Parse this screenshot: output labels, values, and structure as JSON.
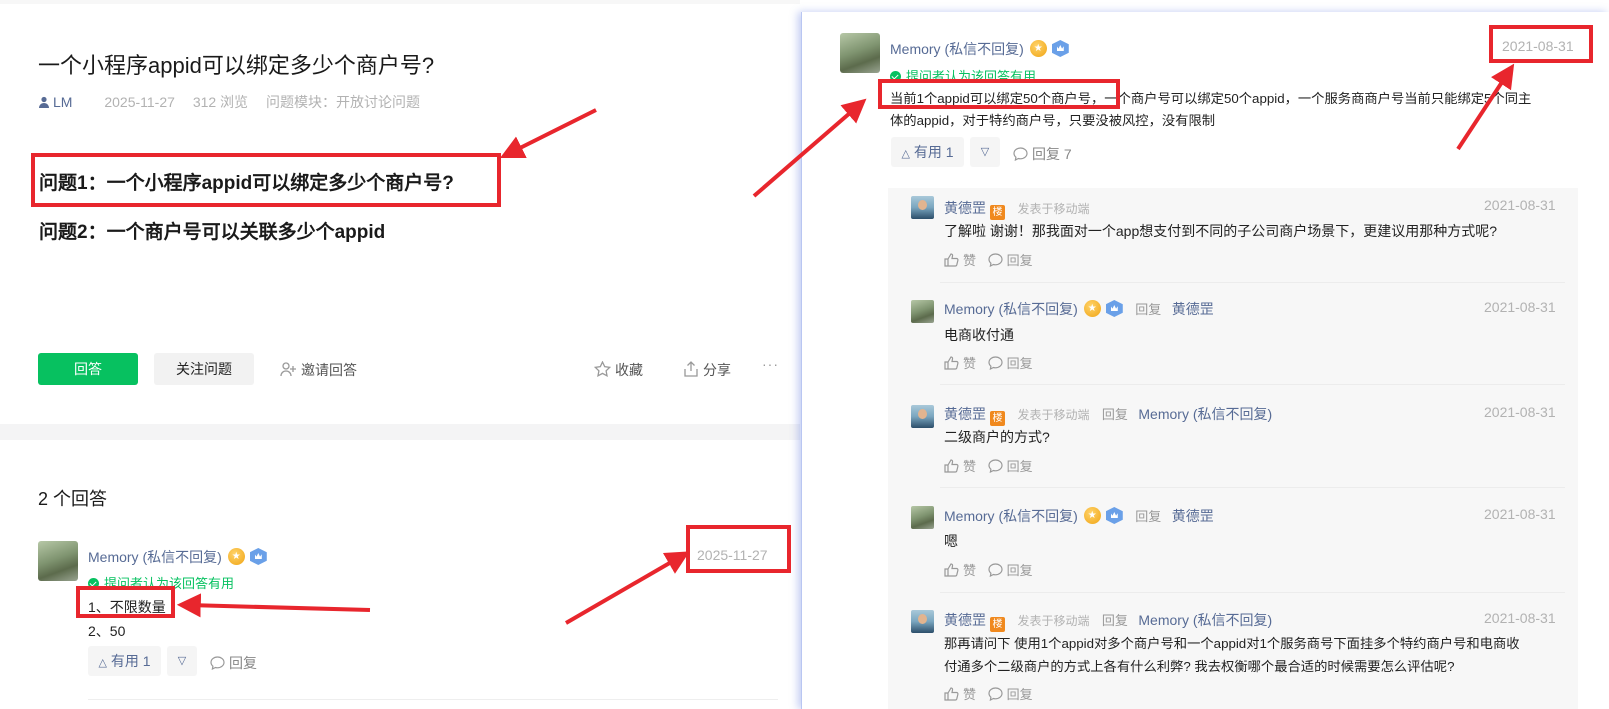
{
  "question": {
    "title": "一个小程序appid可以绑定多少个商户号?",
    "author": "LM",
    "date": "2025-11-27",
    "views": "312 浏览",
    "module": "问题模块：开放讨论问题",
    "q1": "问题1：一个小程序appid可以绑定多少个商户号?",
    "q2": "问题2：一个商户号可以关联多少个appid"
  },
  "actions": {
    "answer": "回答",
    "follow": "关注问题",
    "invite": "邀请回答",
    "favorite": "收藏",
    "share": "分享",
    "more": "···"
  },
  "answers_count": "2 个回答",
  "left_answer": {
    "author": "Memory (私信不回复)",
    "date": "2025-11-27",
    "accepted": "提问者认为该回答有用",
    "line1": "1、不限数量",
    "line2": "2、50",
    "useful": "有用 1",
    "reply": "回复"
  },
  "right_answer": {
    "author": "Memory (私信不回复)",
    "date": "2021-08-31",
    "accepted": "提问者认为该回答有用",
    "highlight": "当前1个appid可以绑定50个商户号，",
    "text_rest": "一个商户号可以绑定50个appid，一个服务商商户号当前只能绑定5个同主",
    "text_line2": "体的appid，对于特约商户号，只要没被风控，没有限制",
    "useful": "有用 1",
    "reply_count": "回复 7"
  },
  "comments": [
    {
      "author": "黄德罡",
      "badge": "楼",
      "source": "发表于移动端",
      "reply_word": "",
      "reply_to": "",
      "date": "2021-08-31",
      "text": "了解啦 谢谢！那我面对一个app想支付到不同的子公司商户场景下，更建议用那种方式呢?",
      "text2": ""
    },
    {
      "author": "Memory (私信不回复)",
      "badge": "",
      "source": "",
      "reply_word": "回复",
      "reply_to": "黄德罡",
      "date": "2021-08-31",
      "text": "电商收付通",
      "text2": ""
    },
    {
      "author": "黄德罡",
      "badge": "楼",
      "source": "发表于移动端",
      "reply_word": "回复",
      "reply_to": "Memory (私信不回复)",
      "date": "2021-08-31",
      "text": "二级商户的方式?",
      "text2": ""
    },
    {
      "author": "Memory (私信不回复)",
      "badge": "",
      "source": "",
      "reply_word": "回复",
      "reply_to": "黄德罡",
      "date": "2021-08-31",
      "text": "嗯",
      "text2": ""
    },
    {
      "author": "黄德罡",
      "badge": "楼",
      "source": "发表于移动端",
      "reply_word": "回复",
      "reply_to": "Memory (私信不回复)",
      "date": "2021-08-31",
      "text": "那再请问下 使用1个appid对多个商户号和一个appid对1个服务商号下面挂多个特约商户号和电商收",
      "text2": "付通多个二级商户的方式上各有什么利弊? 我去权衡哪个最合适的时候需要怎么评估呢?"
    }
  ],
  "comment_actions": {
    "like": "赞",
    "reply": "回复"
  },
  "colors": {
    "accent_green": "#07c160",
    "link_blue": "#576b95",
    "annotation_red": "#e8262d"
  }
}
